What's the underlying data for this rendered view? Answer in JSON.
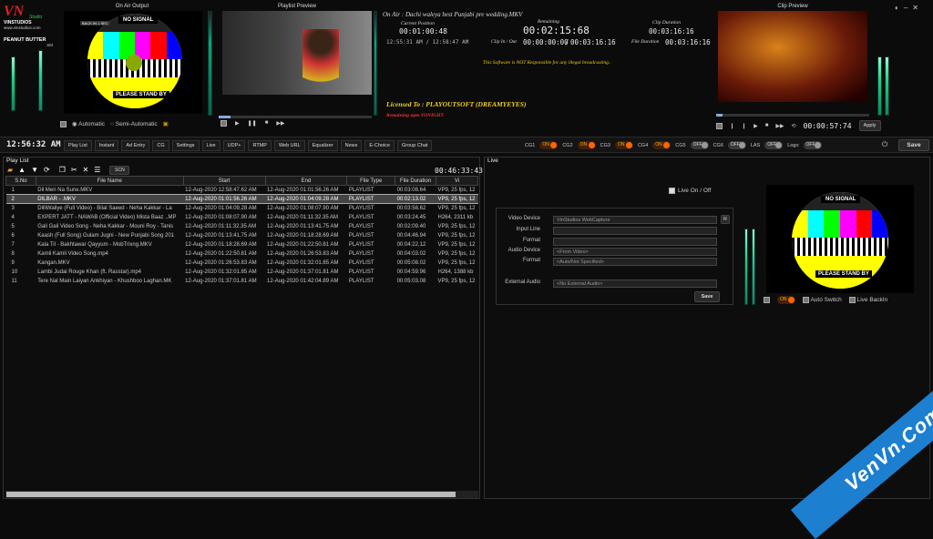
{
  "brand": {
    "logo": "VN",
    "sub": "Studio",
    "name": "VINSTUDIOS",
    "site": "www.vinstudios.com",
    "client": "PEANUT BUTTER",
    "tag": "SM"
  },
  "onair": {
    "title": "On Air Output",
    "nosignal": "NO SIGNAL",
    "standby": "PLEASE STAND BY",
    "overlay": "BACK IN 1 SEC"
  },
  "preview": {
    "title": "Playlist Preview"
  },
  "clip": {
    "title": "Clip Preview",
    "time": "00:00:57:74",
    "apply": "Apply"
  },
  "info": {
    "on_air_label": "On Air : Dachi waleya best Punjabi pre wedding.MKV",
    "current_position_label": "Current Position",
    "current_position": "00:01:00:48",
    "remaining_label": "Remaining",
    "remaining": "00:02:15:68",
    "clip_duration_label": "Clip Duration",
    "clip_duration": "00:03:16:16",
    "clock": "12:55:31 AM / 12:58:47 AM",
    "clip_inout_label": "Clip In / Out",
    "clip_in": "00:00:00:00",
    "clip_out": "00:03:16:16",
    "file_duration_label": "File Duration",
    "file_duration": "00:03:16:16",
    "disclaimer": "This Software is NOT Responsible for any illegal broadcasting..",
    "licensed": "Licensed To : PLAYOUTSOFT (DREAMYEYES)",
    "remaining_upto": "Remaining upto TONIGHT"
  },
  "controls": {
    "automatic": "Automatic",
    "semi": "Semi-Automatic"
  },
  "toolbar": {
    "clock": "12:56:32 AM",
    "tabs": [
      "Play List",
      "Instant",
      "Ad Entry",
      "CG",
      "Settings",
      "Live",
      "UDP+",
      "RTMP",
      "Web URL",
      "Equalizer",
      "News",
      "E-Choice",
      "Group Chat"
    ],
    "toggles": [
      {
        "label": "CG1",
        "state": "ON",
        "on": true
      },
      {
        "label": "CG2",
        "state": "ON",
        "on": true
      },
      {
        "label": "CG3",
        "state": "ON",
        "on": true
      },
      {
        "label": "CG4",
        "state": "ON",
        "on": true
      },
      {
        "label": "CG5",
        "state": "OFF",
        "on": false
      },
      {
        "label": "CG6",
        "state": "OFF",
        "on": false
      },
      {
        "label": "LAS",
        "state": "OFF",
        "on": false
      },
      {
        "label": "Logo",
        "state": "OFF",
        "on": false
      }
    ],
    "save": "Save"
  },
  "playlist": {
    "title": "Play List",
    "scn": "SCN",
    "total": "00:46:33:43",
    "columns": [
      "S.No",
      "File Name",
      "Start",
      "End",
      "File Type",
      "File Duration",
      "Vi"
    ],
    "rows": [
      [
        "1",
        "Dil Meri Na Sune.MKV",
        "12-Aug-2020 12:58:47.62 AM",
        "12-Aug-2020 01:01:56.26 AM",
        "PLAYLIST",
        "00:03:08.64",
        "VP9, 25 fps, 12"
      ],
      [
        "2",
        "DILBAR - .MKV",
        "12-Aug-2020 01:01:56.26 AM",
        "12-Aug-2020 01:04:09.28 AM",
        "PLAYLIST",
        "00:02:13.02",
        "VP9, 25 fps, 12"
      ],
      [
        "3",
        "DilliWaliye (Full Video) - Bilal Saeed - Neha Kakkar - La",
        "12-Aug-2020 01:04:09.28 AM",
        "12-Aug-2020 01:08:07.90 AM",
        "PLAYLIST",
        "00:03:58.62",
        "VP9, 25 fps, 12"
      ],
      [
        "4",
        "EXPERT JATT - NAWAB (Official Video) Mista Baaz ..MP",
        "12-Aug-2020 01:08:07.90 AM",
        "12-Aug-2020 01:11:32.35 AM",
        "PLAYLIST",
        "00:03:24.45",
        "H264, 2311 kb"
      ],
      [
        "5",
        "Gali Gali Video Song - Neha Kakkar - Mouni Roy - Tanis",
        "12-Aug-2020 01:11:32.35 AM",
        "12-Aug-2020 01:13:41.75 AM",
        "PLAYLIST",
        "00:02:09.40",
        "VP9, 25 fps, 12"
      ],
      [
        "6",
        "Kaash (Full Song) Gulam Jugni - New Punjabi Song 201",
        "12-Aug-2020 01:13:41.75 AM",
        "12-Aug-2020 01:18:28.69 AM",
        "PLAYLIST",
        "00:04:46.94",
        "VP9, 25 fps, 12"
      ],
      [
        "7",
        "Kala Til - Bakhtawar Qayyum - MobTrixng.MKV",
        "12-Aug-2020 01:18:28.69 AM",
        "12-Aug-2020 01:22:50.81 AM",
        "PLAYLIST",
        "00:04:22.12",
        "VP9, 25 fps, 12"
      ],
      [
        "8",
        "Kamli Kamli Video Song.mp4",
        "12-Aug-2020 01:22:50.81 AM",
        "12-Aug-2020 01:26:53.83 AM",
        "PLAYLIST",
        "00:04:03.02",
        "VP9, 25 fps, 12"
      ],
      [
        "9",
        "Kangan.MKV",
        "12-Aug-2020 01:26:53.83 AM",
        "12-Aug-2020 01:32:01.85 AM",
        "PLAYLIST",
        "00:05:08.02",
        "VP9, 25 fps, 12"
      ],
      [
        "10",
        "Lambi Judai   Rouge Khan (ft. Rasstar).mp4",
        "12-Aug-2020 01:32:01.85 AM",
        "12-Aug-2020 01:37:01.81 AM",
        "PLAYLIST",
        "00:04:59.96",
        "H264, 1388 kb"
      ],
      [
        "11",
        "Tere Nal Main Laiyan Ankhiyan - Khushboo Laghan.MK",
        "12-Aug-2020 01:37:01.81 AM",
        "12-Aug-2020 01:42:04.89 AM",
        "PLAYLIST",
        "00:05:03.08",
        "VP9, 25 fps, 12"
      ]
    ]
  },
  "live": {
    "title": "Live",
    "liveonoff": "Live On / Off",
    "video_device_label": "Video Device",
    "video_device": "VinStudios WebCapture",
    "r": "R",
    "input_line_label": "Input Line",
    "format_label": "Format",
    "audio_device_label": "Audio Device",
    "audio_device": "<From Video>",
    "format2_label": "Format",
    "format2": "<Auto/Not Specified>",
    "external_audio_label": "External Audio",
    "external_audio": "<No External Audio>",
    "save": "Save",
    "on": "ON",
    "auto_switch": "Auto Switch",
    "live_backin": "Live BackIn"
  },
  "watermark": "VenVn.Com"
}
